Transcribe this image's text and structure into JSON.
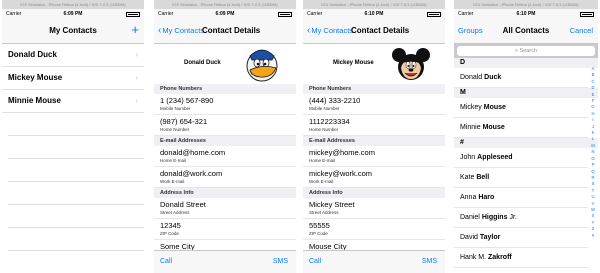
{
  "titlebar": "iOS Simulator - iPhone Retina (4-inch) / iOS 7.0.3 (11B508)",
  "status": {
    "carrier": "Carrier",
    "wifi": "wifi-icon"
  },
  "screen1": {
    "time": "6:09 PM",
    "nav_title": "My Contacts",
    "add_icon": "+",
    "contacts": [
      "Donald Duck",
      "Mickey Mouse",
      "Minnie Mouse"
    ],
    "disclosure": "›"
  },
  "screen2": {
    "time": "6:09 PM",
    "back_label": "My Contacts",
    "nav_title": "Contact Details",
    "name": "Donald Duck",
    "phone_header": "Phone Numbers",
    "phones": [
      {
        "value": "1 (234) 567-890",
        "label": "Mobile Number"
      },
      {
        "value": "(987) 654-321",
        "label": "Home Number"
      }
    ],
    "email_header": "E-mail Addresses",
    "emails": [
      {
        "value": "donald@home.com",
        "label": "Home E-mail"
      },
      {
        "value": "donald@work.com",
        "label": "Work E-mail"
      }
    ],
    "address_header": "Address Info",
    "address": [
      {
        "value": "Donald Street",
        "label": "Street Address"
      },
      {
        "value": "12345",
        "label": "ZIP Code"
      },
      {
        "value": "Some City",
        "label": "City"
      }
    ],
    "call": "Call",
    "sms": "SMS"
  },
  "screen3": {
    "time": "6:10 PM",
    "back_label": "My Contacts",
    "nav_title": "Contact Details",
    "name": "Mickey Mouse",
    "phone_header": "Phone Numbers",
    "phones": [
      {
        "value": "(444) 333-2210",
        "label": "Mobile Number"
      },
      {
        "value": "1112223334",
        "label": "Home Number"
      }
    ],
    "email_header": "E-mail Addresses",
    "emails": [
      {
        "value": "mickey@home.com",
        "label": "Home E-mail"
      },
      {
        "value": "mickey@work.com",
        "label": "Work E-mail"
      }
    ],
    "address_header": "Address Info",
    "address": [
      {
        "value": "Mickey Street",
        "label": "Street Address"
      },
      {
        "value": "55555",
        "label": "ZIP Code"
      },
      {
        "value": "Mouse City",
        "label": "City"
      }
    ],
    "call": "Call",
    "sms": "SMS"
  },
  "screen4": {
    "time": "6:10 PM",
    "left": "Groups",
    "nav_title": "All Contacts",
    "right": "Cancel",
    "search_placeholder": "Search",
    "sections": [
      {
        "letter": "D",
        "rows": [
          {
            "first": "Donald",
            "last": "Duck"
          }
        ]
      },
      {
        "letter": "M",
        "rows": [
          {
            "first": "Mickey",
            "last": "Mouse"
          },
          {
            "first": "Minnie",
            "last": "Mouse"
          }
        ]
      },
      {
        "letter": "#",
        "rows": [
          {
            "first": "John",
            "last": "Appleseed"
          },
          {
            "first": "Kate",
            "last": "Bell"
          },
          {
            "first": "Anna",
            "last": "Haro"
          },
          {
            "first": "Daniel",
            "last": "Higgins",
            "suffix": "Jr."
          },
          {
            "first": "David",
            "last": "Taylor"
          },
          {
            "first": "Hank M.",
            "last": "Zakroff"
          }
        ]
      }
    ],
    "index_letters": [
      "A",
      "B",
      "C",
      "D",
      "E",
      "F",
      "G",
      "H",
      "I",
      "J",
      "K",
      "L",
      "M",
      "N",
      "O",
      "P",
      "Q",
      "R",
      "S",
      "T",
      "U",
      "V",
      "W",
      "X",
      "Y",
      "Z",
      "#"
    ]
  },
  "colors": {
    "accent": "#0a7aff",
    "section_bg": "#efeff4",
    "bar_bg": "#f7f7f7"
  }
}
